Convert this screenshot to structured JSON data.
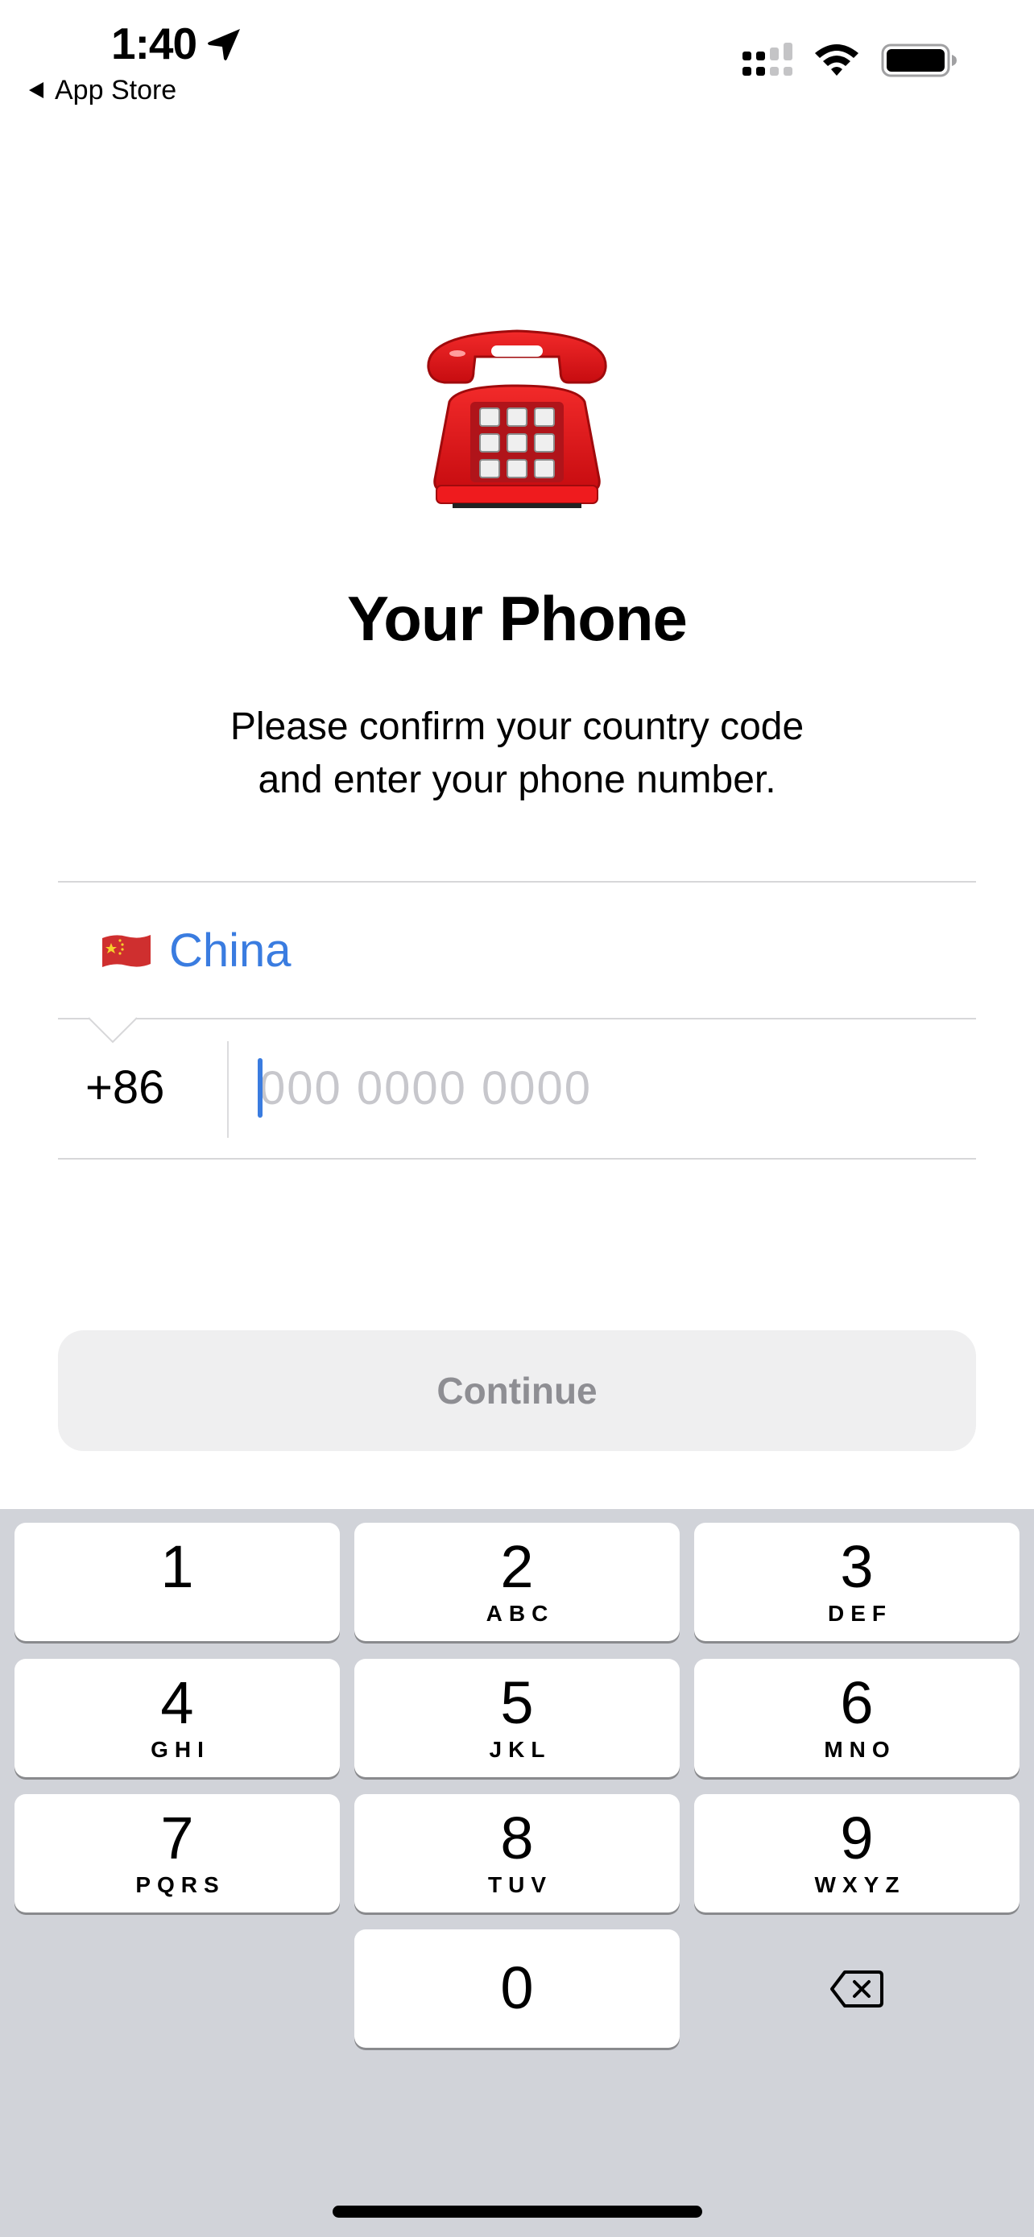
{
  "status_bar": {
    "time": "1:40",
    "location_icon": "location-arrow-icon",
    "back_label": "App Store",
    "signal_icon": "dual-sim-signal-icon",
    "wifi_icon": "wifi-icon",
    "battery_icon": "battery-icon"
  },
  "hero": {
    "icon": "telephone-emoji",
    "title": "Your Phone",
    "subtitle_line1": "Please confirm your country code",
    "subtitle_line2": "and enter your phone number."
  },
  "form": {
    "country": {
      "flag": "china-flag",
      "name": "China"
    },
    "country_code": "+86",
    "phone_number": {
      "value": "",
      "placeholder": "000 0000 0000"
    },
    "continue_label": "Continue"
  },
  "keyboard": {
    "keys": [
      {
        "num": "1",
        "letters": ""
      },
      {
        "num": "2",
        "letters": "ABC"
      },
      {
        "num": "3",
        "letters": "DEF"
      },
      {
        "num": "4",
        "letters": "GHI"
      },
      {
        "num": "5",
        "letters": "JKL"
      },
      {
        "num": "6",
        "letters": "MNO"
      },
      {
        "num": "7",
        "letters": "PQRS"
      },
      {
        "num": "8",
        "letters": "TUV"
      },
      {
        "num": "9",
        "letters": "WXYZ"
      },
      {
        "num": "0",
        "letters": ""
      }
    ],
    "backspace_icon": "delete-backward-icon"
  },
  "colors": {
    "accent": "#3a7ce0",
    "placeholder": "#c7c7cc",
    "button_disabled_bg": "#efeff0",
    "button_disabled_text": "#8e8e93",
    "keyboard_bg": "#d1d3d9"
  }
}
